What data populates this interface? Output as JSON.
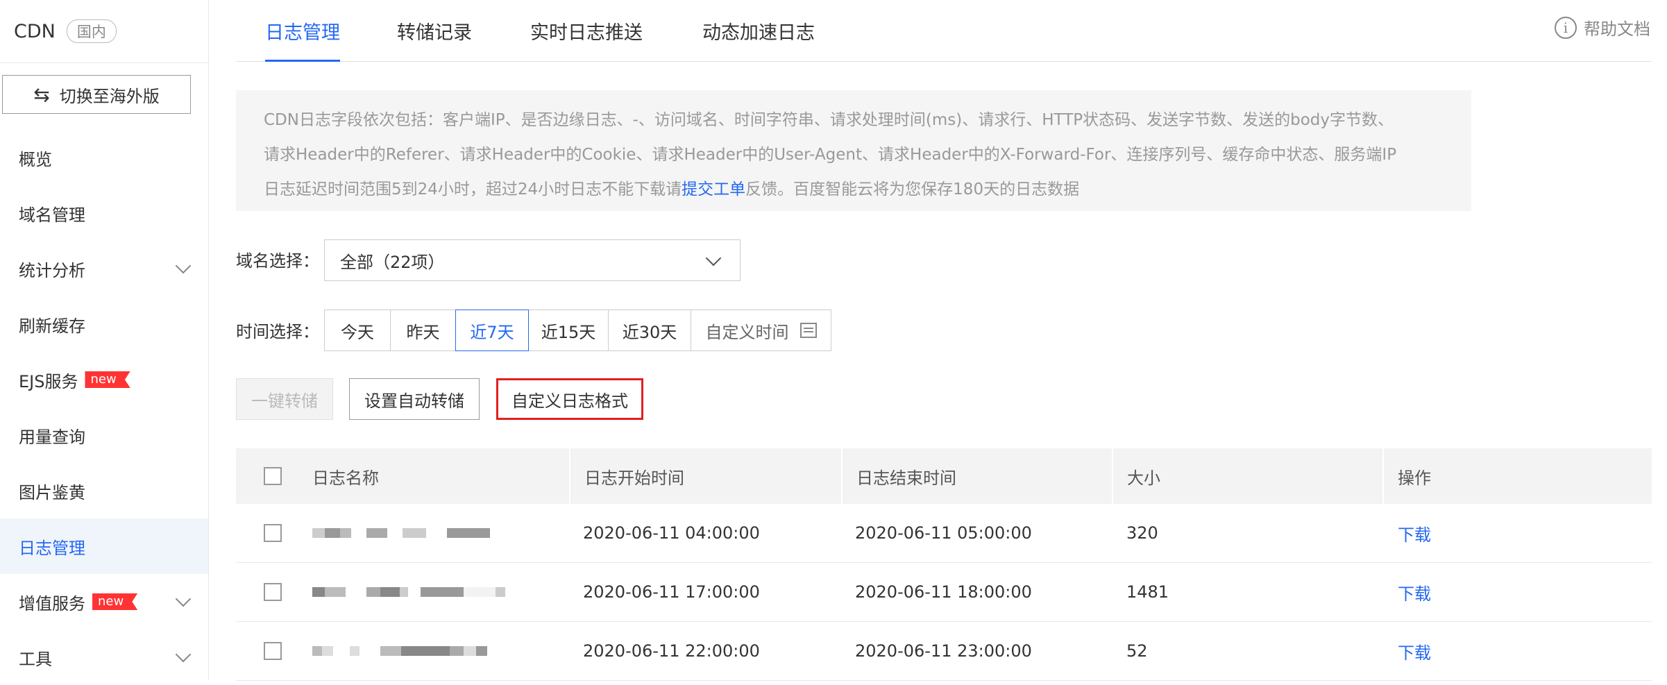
{
  "sidebar": {
    "brand": "CDN",
    "region_tag": "国内",
    "switch_label": "切换至海外版",
    "items": [
      {
        "label": "概览"
      },
      {
        "label": "域名管理"
      },
      {
        "label": "统计分析"
      },
      {
        "label": "刷新缓存"
      },
      {
        "label": "EJS服务",
        "badge": "new"
      },
      {
        "label": "用量查询"
      },
      {
        "label": "图片鉴黄"
      },
      {
        "label": "日志管理"
      },
      {
        "label": "增值服务",
        "badge": "new"
      },
      {
        "label": "工具"
      }
    ]
  },
  "tabs": [
    {
      "label": "日志管理"
    },
    {
      "label": "转储记录"
    },
    {
      "label": "实时日志推送"
    },
    {
      "label": "动态加速日志"
    }
  ],
  "help_label": "帮助文档",
  "notice": {
    "line1": "CDN日志字段依次包括：客户端IP、是否边缘日志、-、访问域名、时间字符串、请求处理时间(ms)、请求行、HTTP状态码、发送字节数、发送的body字节数、",
    "line2": "请求Header中的Referer、请求Header中的Cookie、请求Header中的User-Agent、请求Header中的X-Forward-For、连接序列号、缓存命中状态、服务端IP",
    "line3_pre": "日志延迟时间范围5到24小时，超过24小时日志不能下载请",
    "line3_link": "提交工单",
    "line3_post": "反馈。百度智能云将为您保存180天的日志数据"
  },
  "filters": {
    "domain_label": "域名选择：",
    "domain_value": "全部（22项）",
    "time_label": "时间选择：",
    "time_options": [
      "今天",
      "昨天",
      "近7天",
      "近15天",
      "近30天",
      "自定义时间"
    ]
  },
  "actions": {
    "dump_once": "一键转储",
    "auto_dump": "设置自动转储",
    "custom_format": "自定义日志格式"
  },
  "table": {
    "headers": [
      "日志名称",
      "日志开始时间",
      "日志结束时间",
      "大小",
      "操作"
    ],
    "rows": [
      {
        "start": "2020-06-11 04:00:00",
        "end": "2020-06-11 05:00:00",
        "size": "320",
        "action": "下载"
      },
      {
        "start": "2020-06-11 17:00:00",
        "end": "2020-06-11 18:00:00",
        "size": "1481",
        "action": "下载"
      },
      {
        "start": "2020-06-11 22:00:00",
        "end": "2020-06-11 23:00:00",
        "size": "52",
        "action": "下载"
      }
    ]
  }
}
